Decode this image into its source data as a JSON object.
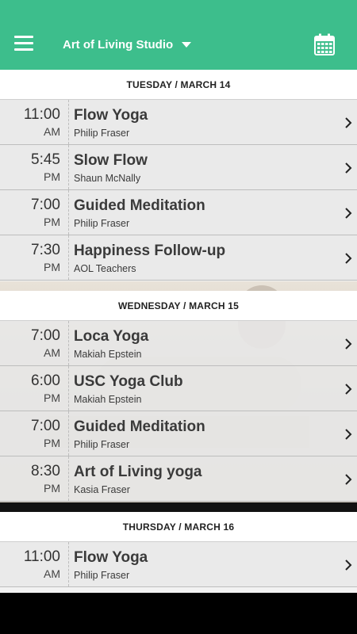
{
  "header": {
    "studio": "Art of Living Studio"
  },
  "days": [
    {
      "label": "TUESDAY / MARCH 14",
      "classes": [
        {
          "time": "11:00",
          "ampm": "AM",
          "title": "Flow Yoga",
          "teacher": "Philip Fraser"
        },
        {
          "time": "5:45",
          "ampm": "PM",
          "title": "Slow Flow",
          "teacher": "Shaun McNally"
        },
        {
          "time": "7:00",
          "ampm": "PM",
          "title": "Guided Meditation",
          "teacher": "Philip Fraser"
        },
        {
          "time": "7:30",
          "ampm": "PM",
          "title": "Happiness Follow-up",
          "teacher": "AOL Teachers"
        }
      ]
    },
    {
      "label": "WEDNESDAY / MARCH 15",
      "classes": [
        {
          "time": "7:00",
          "ampm": "AM",
          "title": "Loca Yoga",
          "teacher": "Makiah Epstein"
        },
        {
          "time": "6:00",
          "ampm": "PM",
          "title": "USC Yoga Club",
          "teacher": "Makiah Epstein"
        },
        {
          "time": "7:00",
          "ampm": "PM",
          "title": "Guided Meditation",
          "teacher": "Philip Fraser"
        },
        {
          "time": "8:30",
          "ampm": "PM",
          "title": "Art of Living yoga",
          "teacher": "Kasia Fraser"
        }
      ]
    },
    {
      "label": "THURSDAY / MARCH 16",
      "classes": [
        {
          "time": "11:00",
          "ampm": "AM",
          "title": "Flow Yoga",
          "teacher": "Philip Fraser"
        }
      ]
    }
  ],
  "colors": {
    "accent": "#3dbe8c"
  }
}
